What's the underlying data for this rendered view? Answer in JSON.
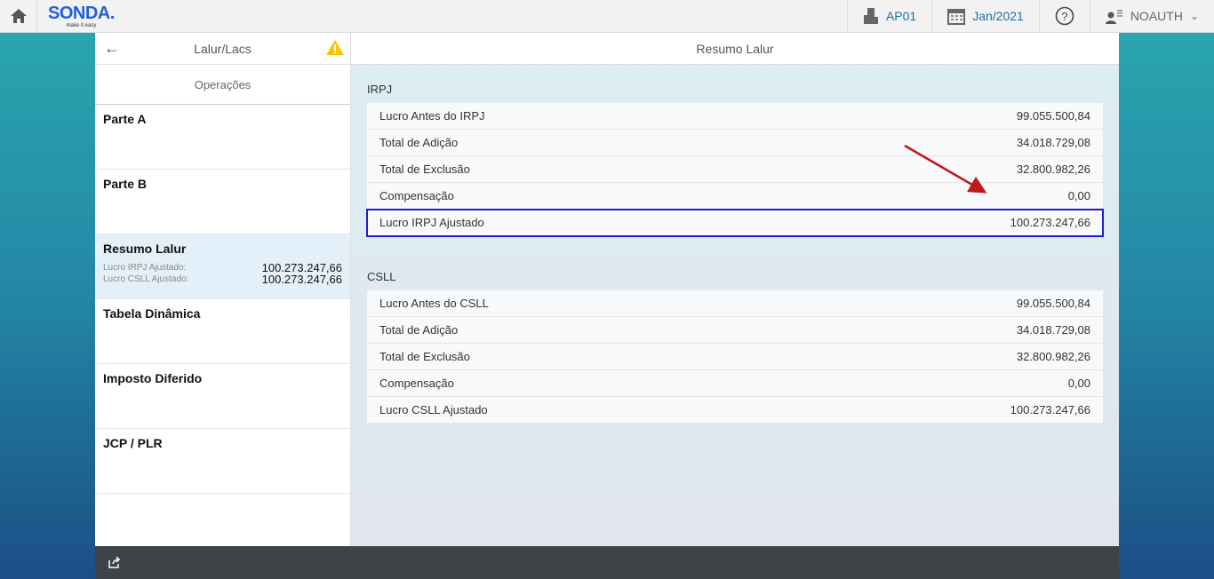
{
  "header": {
    "logo": "SONDA.",
    "tagline": "make it easy",
    "company": "AP01",
    "period": "Jan/2021",
    "user": "NOAUTH"
  },
  "sidebar": {
    "title": "Lalur/Lacs",
    "tab": "Operações",
    "items": [
      {
        "label": "Parte A"
      },
      {
        "label": "Parte B"
      },
      {
        "label": "Resumo Lalur",
        "details": [
          {
            "k": "Lucro IRPJ Ajustado:",
            "v": "100.273.247,66"
          },
          {
            "k": "Lucro CSLL Ajustado:",
            "v": "100.273.247,66"
          }
        ]
      },
      {
        "label": "Tabela Dinâmica"
      },
      {
        "label": "Imposto Diferido"
      },
      {
        "label": "JCP / PLR"
      }
    ]
  },
  "content": {
    "title": "Resumo Lalur",
    "irpj": {
      "title": "IRPJ",
      "rows": [
        {
          "k": "Lucro Antes do IRPJ",
          "v": "99.055.500,84"
        },
        {
          "k": "Total de Adição",
          "v": "34.018.729,08"
        },
        {
          "k": "Total de Exclusão",
          "v": "32.800.982,26"
        },
        {
          "k": "Compensação",
          "v": "0,00"
        },
        {
          "k": "Lucro IRPJ Ajustado",
          "v": "100.273.247,66"
        }
      ]
    },
    "csll": {
      "title": "CSLL",
      "rows": [
        {
          "k": "Lucro Antes do CSLL",
          "v": "99.055.500,84"
        },
        {
          "k": "Total de Adição",
          "v": "34.018.729,08"
        },
        {
          "k": "Total de Exclusão",
          "v": "32.800.982,26"
        },
        {
          "k": "Compensação",
          "v": "0,00"
        },
        {
          "k": "Lucro CSLL Ajustado",
          "v": "100.273.247,66"
        }
      ]
    }
  }
}
